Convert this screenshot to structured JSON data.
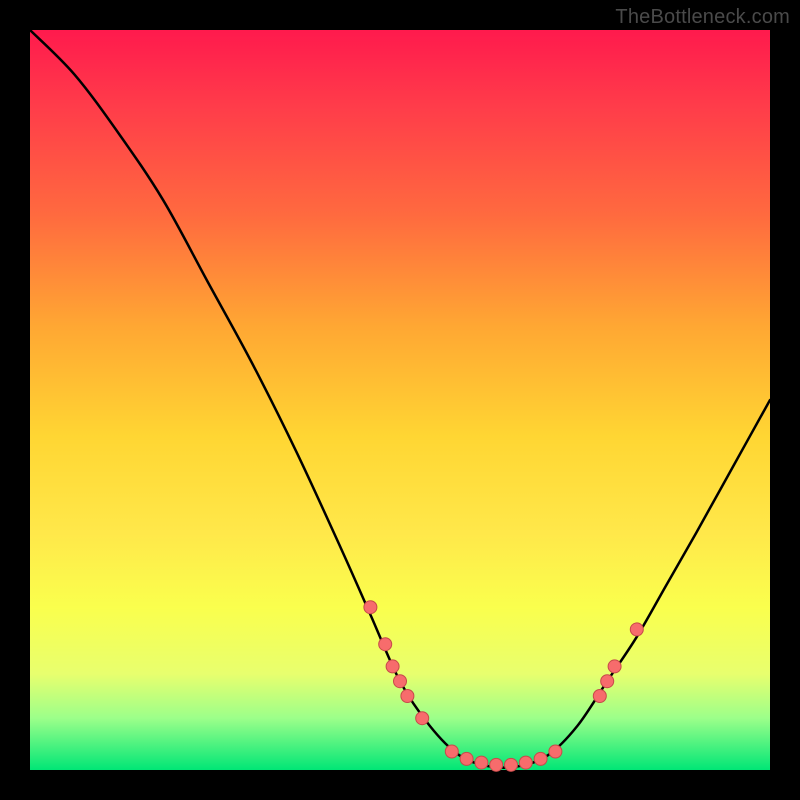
{
  "watermark": "TheBottleneck.com",
  "chart_data": {
    "type": "line",
    "title": "",
    "xlabel": "",
    "ylabel": "",
    "xlim": [
      0,
      100
    ],
    "ylim": [
      0,
      100
    ],
    "curve": [
      {
        "x": 0,
        "y": 100
      },
      {
        "x": 6,
        "y": 94
      },
      {
        "x": 12,
        "y": 86
      },
      {
        "x": 18,
        "y": 77
      },
      {
        "x": 24,
        "y": 66
      },
      {
        "x": 30,
        "y": 55
      },
      {
        "x": 36,
        "y": 43
      },
      {
        "x": 42,
        "y": 30
      },
      {
        "x": 46,
        "y": 21
      },
      {
        "x": 50,
        "y": 12
      },
      {
        "x": 54,
        "y": 6
      },
      {
        "x": 58,
        "y": 2
      },
      {
        "x": 62,
        "y": 0.5
      },
      {
        "x": 66,
        "y": 0.5
      },
      {
        "x": 70,
        "y": 2
      },
      {
        "x": 74,
        "y": 6
      },
      {
        "x": 78,
        "y": 12
      },
      {
        "x": 82,
        "y": 18
      },
      {
        "x": 86,
        "y": 25
      },
      {
        "x": 90,
        "y": 32
      },
      {
        "x": 95,
        "y": 41
      },
      {
        "x": 100,
        "y": 50
      }
    ],
    "points": [
      {
        "x": 46,
        "y": 22
      },
      {
        "x": 48,
        "y": 17
      },
      {
        "x": 49,
        "y": 14
      },
      {
        "x": 50,
        "y": 12
      },
      {
        "x": 51,
        "y": 10
      },
      {
        "x": 53,
        "y": 7
      },
      {
        "x": 57,
        "y": 2.5
      },
      {
        "x": 59,
        "y": 1.5
      },
      {
        "x": 61,
        "y": 1
      },
      {
        "x": 63,
        "y": 0.7
      },
      {
        "x": 65,
        "y": 0.7
      },
      {
        "x": 67,
        "y": 1
      },
      {
        "x": 69,
        "y": 1.5
      },
      {
        "x": 71,
        "y": 2.5
      },
      {
        "x": 77,
        "y": 10
      },
      {
        "x": 78,
        "y": 12
      },
      {
        "x": 79,
        "y": 14
      },
      {
        "x": 82,
        "y": 19
      }
    ]
  }
}
